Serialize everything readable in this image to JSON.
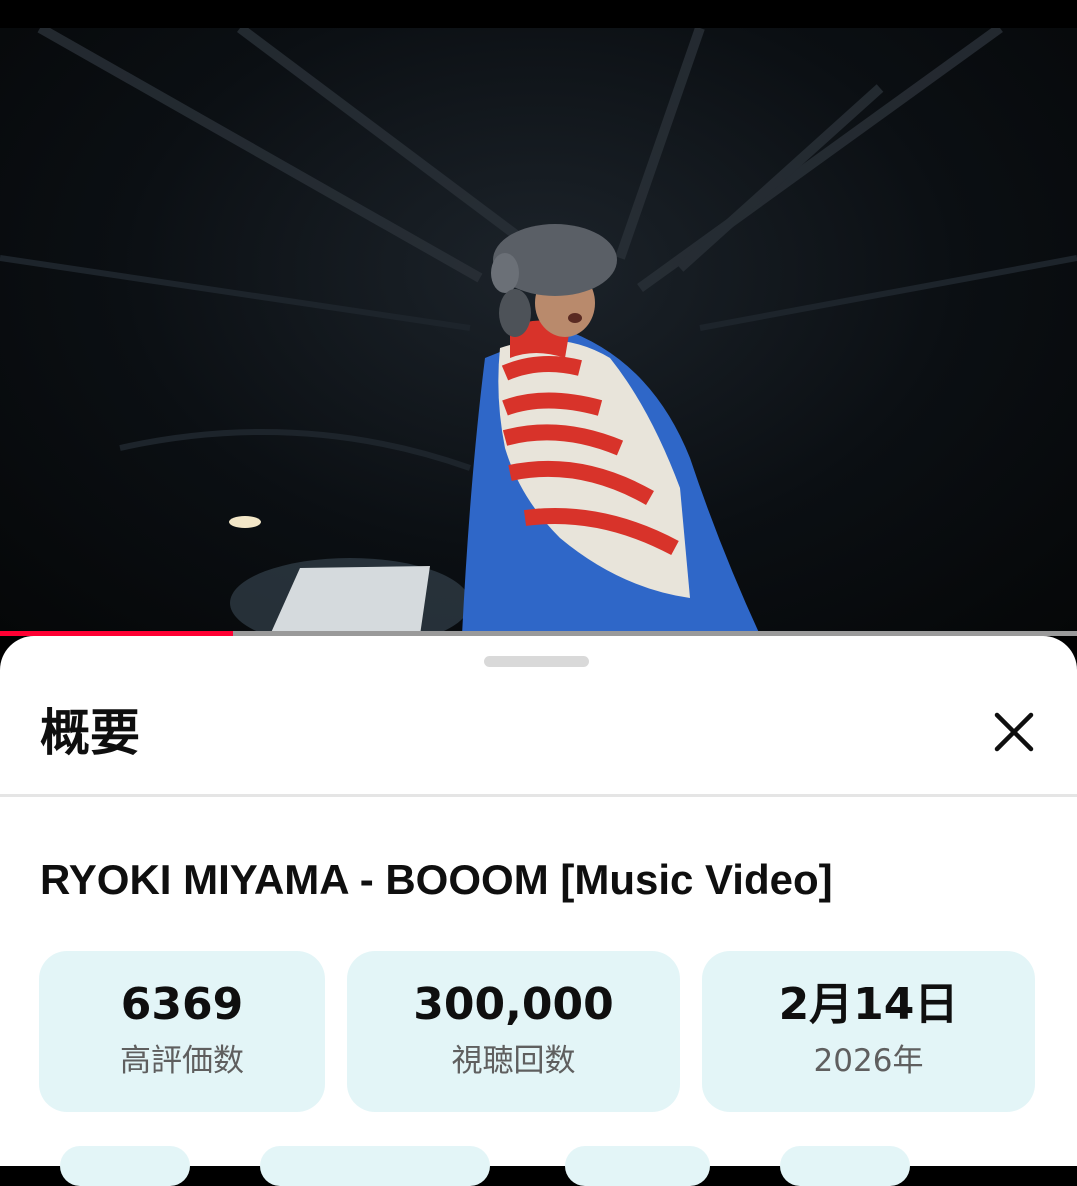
{
  "player": {
    "progress_fraction": 0.216,
    "colors": {
      "progress_played": "#ff0033",
      "progress_track": "#9a9a9a"
    }
  },
  "sheet": {
    "title": "概要",
    "close_icon": "close-icon"
  },
  "video": {
    "title": "RYOKI MIYAMA - BOOOM [Music Video]"
  },
  "stats": [
    {
      "value": "6369",
      "label": "高評価数"
    },
    {
      "value": "300,000",
      "label": "視聴回数"
    },
    {
      "value": "2月14日",
      "label": "2026年"
    }
  ],
  "colors": {
    "card_background": "#e3f5f7",
    "sheet_background": "#ffffff",
    "text_primary": "#0f0f0f",
    "text_secondary": "#5f5f5f"
  }
}
